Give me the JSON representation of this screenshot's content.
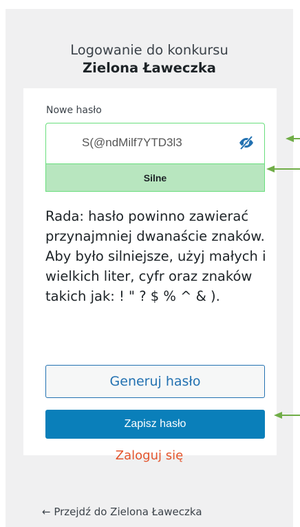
{
  "header": {
    "title_line1": "Logowanie do konkursu",
    "title_line2": "Zielona Ławeczka"
  },
  "form": {
    "password_label": "Nowe hasło",
    "password_value": "S(@ndMilf7YTD3l3",
    "strength_text": "Silne",
    "hint": "Rada: hasło powinno zawierać przynajmniej dwanaście znaków. Aby było silniejsze, użyj małych i wielkich liter, cyfr oraz znaków takich jak: ! \" ? $ % ^ & ).",
    "generate_label": "Generuj hasło",
    "save_label": "Zapisz hasło"
  },
  "footer": {
    "login_link": "Zaloguj się",
    "back_link": "← Przejdź do Zielona Ławeczka"
  },
  "icons": {
    "visibility_toggle": "eye-slash-icon",
    "annotation_arrow": "arrow-left-icon"
  },
  "colors": {
    "strength_bg": "#b8e6bf",
    "strength_border": "#68de7c",
    "primary": "#0a7fba",
    "link_accent": "#e4542c",
    "annotation": "#70ad47"
  }
}
